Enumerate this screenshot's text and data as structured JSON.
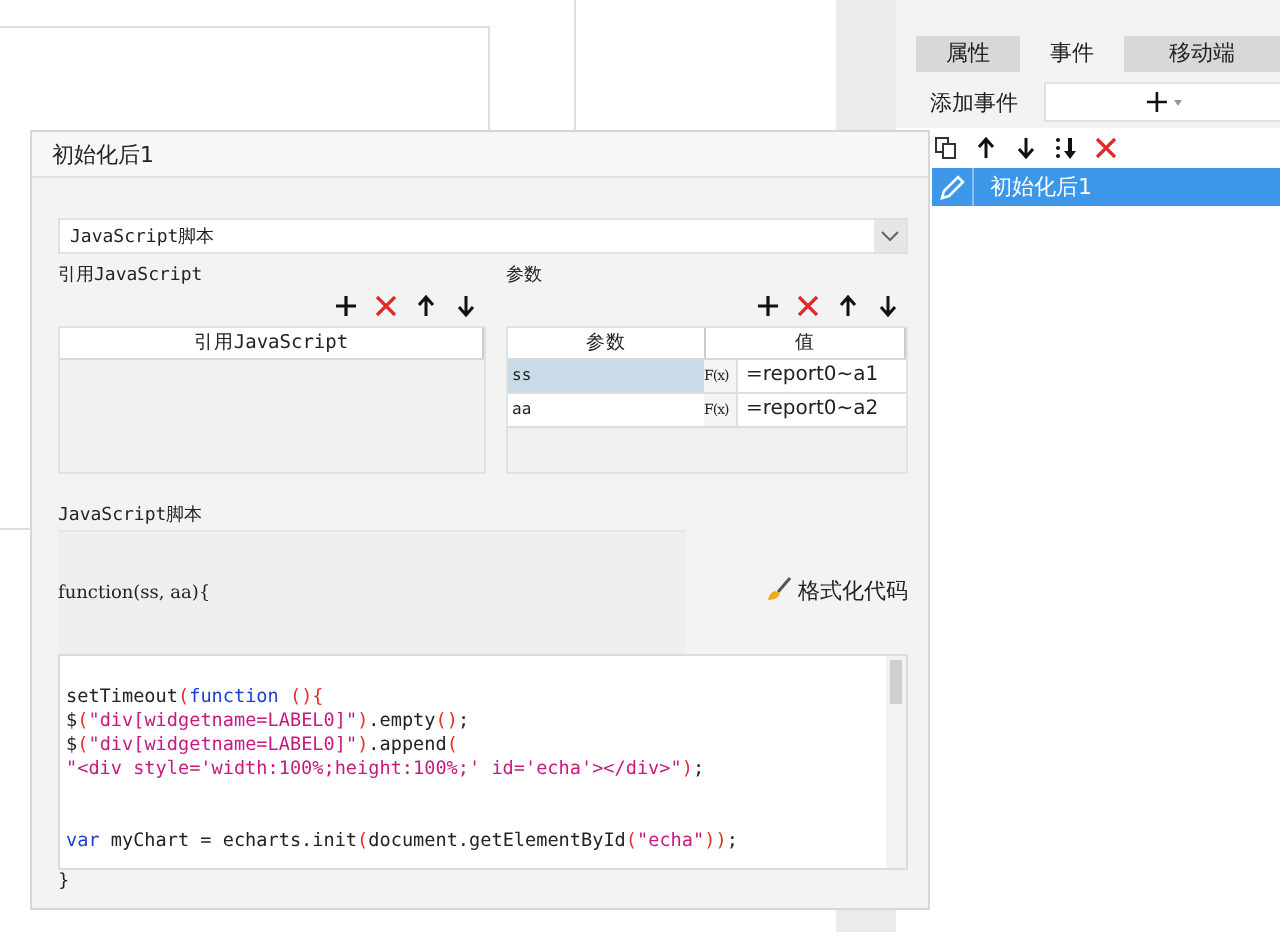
{
  "side_panel": {
    "tabs": [
      {
        "label": "属性",
        "selected": false
      },
      {
        "label": "事件",
        "selected": true
      },
      {
        "label": "移动端",
        "selected": false
      }
    ],
    "add_event": {
      "label": "添加事件",
      "button": "+"
    },
    "toolbar": [
      {
        "kind": "copy"
      },
      {
        "kind": "up"
      },
      {
        "kind": "down"
      },
      {
        "kind": "bottom"
      },
      {
        "kind": "delete"
      }
    ],
    "events": [
      {
        "label": "初始化后1",
        "selected": true
      }
    ]
  },
  "dialog": {
    "title": "初始化后1",
    "script_type": "JavaScript脚本",
    "ref_section": {
      "label": "引用JavaScript",
      "toolbar": [
        {
          "kind": "add"
        },
        {
          "kind": "delete"
        },
        {
          "kind": "up"
        },
        {
          "kind": "down"
        }
      ],
      "column": "引用JavaScript"
    },
    "params_section": {
      "label": "参数",
      "toolbar": [
        {
          "kind": "add"
        },
        {
          "kind": "delete"
        },
        {
          "kind": "up"
        },
        {
          "kind": "down"
        }
      ],
      "columns": [
        "参数",
        "值"
      ],
      "rows": [
        {
          "name": "ss",
          "formula": "F(x)",
          "value": "=report0~a1",
          "selected": true
        },
        {
          "name": "aa",
          "formula": "F(x)",
          "value": "=report0~a2",
          "selected": false
        }
      ]
    },
    "script_section": {
      "label": "JavaScript脚本",
      "signature": "function(ss, aa){",
      "format_button": "格式化代码",
      "code": [
        {
          "kind": "blank"
        },
        {
          "kind": "code",
          "tokens": [
            {
              "kind": "plain",
              "text": "setTimeout"
            },
            {
              "kind": "punct",
              "text": "("
            },
            {
              "kind": "keyword",
              "text": "function"
            },
            {
              "kind": "punct",
              "text": " (){"
            }
          ]
        },
        {
          "kind": "code",
          "tokens": [
            {
              "kind": "plain",
              "text": "$"
            },
            {
              "kind": "punct",
              "text": "("
            },
            {
              "kind": "string",
              "text": "\"div[widgetname=LABEL0]\""
            },
            {
              "kind": "punct",
              "text": ")"
            },
            {
              "kind": "plain",
              "text": ".empty"
            },
            {
              "kind": "punct",
              "text": "()"
            },
            {
              "kind": "plain",
              "text": ";"
            }
          ]
        },
        {
          "kind": "code",
          "tokens": [
            {
              "kind": "plain",
              "text": "$"
            },
            {
              "kind": "punct",
              "text": "("
            },
            {
              "kind": "string",
              "text": "\"div[widgetname=LABEL0]\""
            },
            {
              "kind": "punct",
              "text": ")"
            },
            {
              "kind": "plain",
              "text": ".append"
            },
            {
              "kind": "punct",
              "text": "("
            }
          ]
        },
        {
          "kind": "code",
          "tokens": [
            {
              "kind": "string",
              "text": "\"<div style='width:100%;height:100%;' id='echa'></div>\""
            },
            {
              "kind": "punct",
              "text": ")"
            },
            {
              "kind": "plain",
              "text": ";"
            }
          ]
        },
        {
          "kind": "blank"
        },
        {
          "kind": "blank"
        },
        {
          "kind": "code",
          "tokens": [
            {
              "kind": "keyword",
              "text": "var"
            },
            {
              "kind": "plain",
              "text": " myChart = echarts.init"
            },
            {
              "kind": "punct",
              "text": "("
            },
            {
              "kind": "plain",
              "text": "document.getElementById"
            },
            {
              "kind": "punct",
              "text": "("
            },
            {
              "kind": "string",
              "text": "\"echa\""
            },
            {
              "kind": "punct",
              "text": "))"
            },
            {
              "kind": "plain",
              "text": ";"
            }
          ]
        }
      ],
      "closing": "}"
    }
  }
}
